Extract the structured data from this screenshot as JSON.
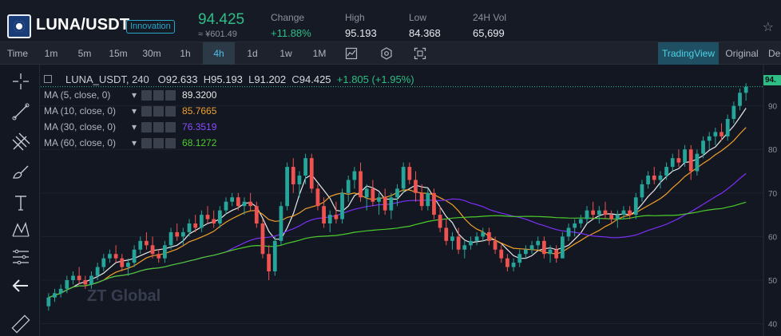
{
  "ticker": {
    "pair": "LUNA/USDT",
    "badge": "Innovation",
    "price": "94.425",
    "fiat_price": "≈ ¥601.49",
    "stats": [
      {
        "label": "Change",
        "value": "+11.88%",
        "up": true
      },
      {
        "label": "High",
        "value": "95.193",
        "up": false
      },
      {
        "label": "Low",
        "value": "84.368",
        "up": false
      },
      {
        "label": "24H Vol",
        "value": "65,699",
        "up": false
      }
    ],
    "icons": {
      "favorite": "star-outline-icon",
      "logo": "luna-logo-icon"
    }
  },
  "toolbar": {
    "intervals": [
      "Time",
      "1m",
      "5m",
      "15m",
      "30m",
      "1h",
      "4h",
      "1d",
      "1w",
      "1M"
    ],
    "active_interval": "4h",
    "icons": [
      "area-chart-icon",
      "settings-hex-icon",
      "fullscreen-icon"
    ],
    "views": [
      "TradingView",
      "Original",
      "De"
    ],
    "active_view": "TradingView"
  },
  "left_tools": [
    "crosshair-icon",
    "trendline-icon",
    "pitchfork-icon",
    "brush-icon",
    "text-tool-icon",
    "pattern-icon",
    "measure-icon",
    "back-arrow-icon",
    "ruler-icon"
  ],
  "legend": {
    "symbol": "LUNA_USDT, 240",
    "open_label": "O",
    "open": "92.633",
    "high_label": "H",
    "high": "95.193",
    "low_label": "L",
    "low": "91.202",
    "close_label": "C",
    "close": "94.425",
    "change": "+1.805 (+1.95%)",
    "studies": [
      {
        "name": "MA (5, close, 0)",
        "value": "89.3200",
        "color": "#e8e8e8"
      },
      {
        "name": "MA (10, close, 0)",
        "value": "85.7665",
        "color": "#f0a029"
      },
      {
        "name": "MA (30, close, 0)",
        "value": "76.3519",
        "color": "#7b2ff7"
      },
      {
        "name": "MA (60, close, 0)",
        "value": "68.1272",
        "color": "#4ccd2b"
      }
    ]
  },
  "watermark": "ZT Global",
  "last_price_label": "94.",
  "colors": {
    "up": "#26a69a",
    "down": "#ef5350",
    "accent": "#4fc0e8",
    "price_up": "#2ebd85"
  },
  "chart_data": {
    "type": "candlestick",
    "y_ticks": [
      "90",
      "80",
      "70",
      "60",
      "50",
      "40"
    ],
    "ylim": [
      39,
      98
    ],
    "ohlc": [
      [
        44,
        47,
        43,
        46
      ],
      [
        46,
        48,
        45,
        47
      ],
      [
        47,
        49,
        46,
        48
      ],
      [
        48,
        51,
        47,
        50
      ],
      [
        50,
        52,
        49,
        51
      ],
      [
        51,
        53,
        49,
        50
      ],
      [
        50,
        51,
        48,
        49
      ],
      [
        49,
        52,
        48,
        51
      ],
      [
        51,
        54,
        50,
        53
      ],
      [
        53,
        56,
        52,
        55
      ],
      [
        55,
        57,
        54,
        56
      ],
      [
        56,
        58,
        54,
        55
      ],
      [
        55,
        56,
        52,
        53
      ],
      [
        53,
        55,
        51,
        54
      ],
      [
        54,
        58,
        53,
        57
      ],
      [
        57,
        60,
        56,
        59
      ],
      [
        59,
        61,
        57,
        58
      ],
      [
        58,
        60,
        55,
        56
      ],
      [
        56,
        57,
        54,
        55
      ],
      [
        55,
        59,
        54,
        58
      ],
      [
        58,
        62,
        57,
        61
      ],
      [
        61,
        63,
        59,
        60
      ],
      [
        60,
        62,
        58,
        61
      ],
      [
        61,
        64,
        60,
        63
      ],
      [
        63,
        65,
        61,
        62
      ],
      [
        62,
        66,
        61,
        65
      ],
      [
        65,
        67,
        63,
        64
      ],
      [
        64,
        66,
        62,
        63
      ],
      [
        63,
        67,
        62,
        66
      ],
      [
        66,
        69,
        65,
        68
      ],
      [
        68,
        70,
        67,
        69
      ],
      [
        69,
        70,
        66,
        67
      ],
      [
        67,
        69,
        65,
        68
      ],
      [
        68,
        70,
        66,
        67
      ],
      [
        67,
        68,
        62,
        63
      ],
      [
        63,
        64,
        55,
        56
      ],
      [
        56,
        58,
        50,
        52
      ],
      [
        52,
        60,
        51,
        59
      ],
      [
        59,
        68,
        58,
        67
      ],
      [
        67,
        77,
        66,
        76
      ],
      [
        76,
        78,
        70,
        72
      ],
      [
        72,
        75,
        69,
        74
      ],
      [
        74,
        79,
        72,
        78
      ],
      [
        78,
        79,
        70,
        71
      ],
      [
        71,
        72,
        66,
        67
      ],
      [
        67,
        69,
        62,
        63
      ],
      [
        63,
        66,
        61,
        65
      ],
      [
        65,
        68,
        63,
        64
      ],
      [
        64,
        71,
        63,
        70
      ],
      [
        70,
        74,
        68,
        73
      ],
      [
        73,
        76,
        71,
        75
      ],
      [
        75,
        77,
        68,
        69
      ],
      [
        69,
        72,
        66,
        71
      ],
      [
        71,
        73,
        67,
        68
      ],
      [
        68,
        70,
        65,
        69
      ],
      [
        69,
        71,
        65,
        66
      ],
      [
        66,
        70,
        64,
        69
      ],
      [
        69,
        72,
        67,
        71
      ],
      [
        71,
        77,
        70,
        76
      ],
      [
        76,
        77,
        72,
        73
      ],
      [
        73,
        75,
        68,
        70
      ],
      [
        70,
        72,
        66,
        67
      ],
      [
        67,
        71,
        66,
        70
      ],
      [
        70,
        71,
        64,
        65
      ],
      [
        65,
        67,
        61,
        62
      ],
      [
        62,
        64,
        58,
        59
      ],
      [
        59,
        61,
        57,
        60
      ],
      [
        60,
        62,
        56,
        57
      ],
      [
        57,
        59,
        55,
        58
      ],
      [
        58,
        60,
        57,
        59
      ],
      [
        59,
        61,
        58,
        60
      ],
      [
        60,
        62,
        59,
        61
      ],
      [
        61,
        62,
        58,
        59
      ],
      [
        59,
        60,
        56,
        57
      ],
      [
        57,
        58,
        54,
        55
      ],
      [
        55,
        56,
        52,
        53
      ],
      [
        53,
        55,
        52,
        54
      ],
      [
        54,
        57,
        53,
        56
      ],
      [
        56,
        58,
        55,
        57
      ],
      [
        57,
        59,
        56,
        58
      ],
      [
        58,
        60,
        57,
        59
      ],
      [
        59,
        60,
        55,
        56
      ],
      [
        56,
        58,
        54,
        57
      ],
      [
        57,
        58,
        54,
        55
      ],
      [
        55,
        61,
        55,
        60
      ],
      [
        60,
        63,
        59,
        62
      ],
      [
        62,
        64,
        60,
        63
      ],
      [
        63,
        65,
        62,
        64
      ],
      [
        64,
        67,
        63,
        66
      ],
      [
        66,
        68,
        64,
        65
      ],
      [
        65,
        67,
        63,
        66
      ],
      [
        66,
        68,
        64,
        65
      ],
      [
        65,
        66,
        63,
        64
      ],
      [
        64,
        66,
        62,
        65
      ],
      [
        65,
        67,
        64,
        66
      ],
      [
        66,
        67,
        64,
        65
      ],
      [
        65,
        70,
        64,
        69
      ],
      [
        69,
        73,
        68,
        72
      ],
      [
        72,
        75,
        71,
        74
      ],
      [
        74,
        76,
        72,
        73
      ],
      [
        73,
        75,
        71,
        74
      ],
      [
        74,
        77,
        73,
        76
      ],
      [
        76,
        79,
        75,
        78
      ],
      [
        78,
        80,
        76,
        77
      ],
      [
        77,
        81,
        76,
        80
      ],
      [
        80,
        81,
        73,
        75
      ],
      [
        75,
        80,
        74,
        79
      ],
      [
        79,
        83,
        78,
        82
      ],
      [
        82,
        84,
        80,
        83
      ],
      [
        83,
        85,
        81,
        84
      ],
      [
        84,
        86,
        82,
        83
      ],
      [
        83,
        88,
        82,
        87
      ],
      [
        87,
        91,
        86,
        90
      ],
      [
        90,
        94,
        89,
        93
      ],
      [
        93,
        95.2,
        91.2,
        94.4
      ]
    ],
    "ma": [
      {
        "name": "MA (5, close, 0)",
        "period": 5,
        "color": "#e8e8e8"
      },
      {
        "name": "MA (10, close, 0)",
        "period": 10,
        "color": "#f0a029"
      },
      {
        "name": "MA (30, close, 0)",
        "period": 30,
        "color": "#7b2ff7"
      },
      {
        "name": "MA (60, close, 0)",
        "period": 60,
        "color": "#4ccd2b"
      }
    ]
  }
}
